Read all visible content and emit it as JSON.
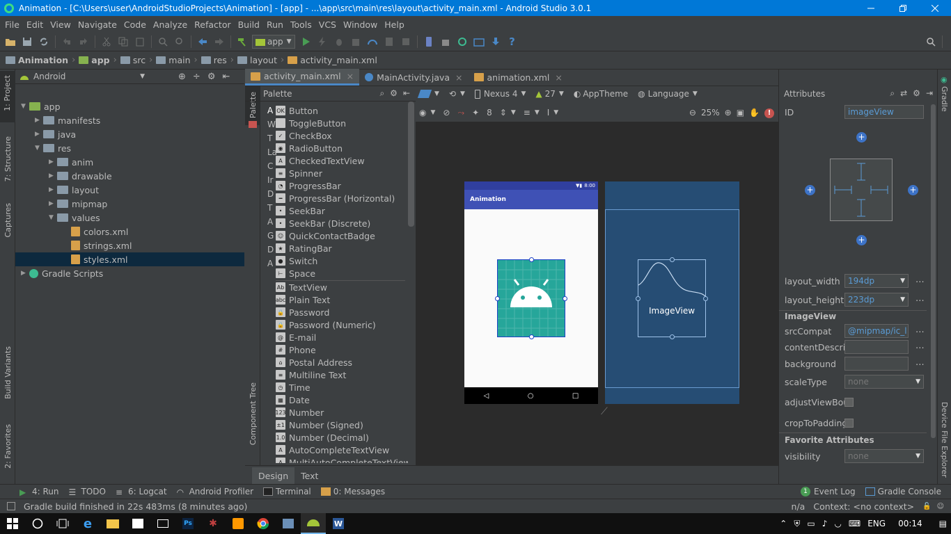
{
  "window": {
    "title": "Animation - [C:\\Users\\user\\AndroidStudioProjects\\Animation] - [app] - ...\\app\\src\\main\\res\\layout\\activity_main.xml - Android Studio 3.0.1"
  },
  "menu": [
    "File",
    "Edit",
    "View",
    "Navigate",
    "Code",
    "Analyze",
    "Refactor",
    "Build",
    "Run",
    "Tools",
    "VCS",
    "Window",
    "Help"
  ],
  "toolbar": {
    "run_config": "app"
  },
  "breadcrumb": [
    "Animation",
    "app",
    "src",
    "main",
    "res",
    "layout",
    "activity_main.xml"
  ],
  "left_stripe": {
    "project": "1: Project",
    "structure": "7: Structure",
    "captures": "Captures",
    "build_variants": "Build Variants",
    "favorites": "2: Favorites"
  },
  "project": {
    "view_mode": "Android",
    "tree": [
      {
        "label": "app",
        "depth": 0,
        "expanded": true,
        "kind": "module"
      },
      {
        "label": "manifests",
        "depth": 1,
        "expanded": false,
        "kind": "folder"
      },
      {
        "label": "java",
        "depth": 1,
        "expanded": false,
        "kind": "folder"
      },
      {
        "label": "res",
        "depth": 1,
        "expanded": true,
        "kind": "resfolder"
      },
      {
        "label": "anim",
        "depth": 2,
        "expanded": false,
        "kind": "folder"
      },
      {
        "label": "drawable",
        "depth": 2,
        "expanded": false,
        "kind": "folder"
      },
      {
        "label": "layout",
        "depth": 2,
        "expanded": false,
        "kind": "folder"
      },
      {
        "label": "mipmap",
        "depth": 2,
        "expanded": false,
        "kind": "folder"
      },
      {
        "label": "values",
        "depth": 2,
        "expanded": true,
        "kind": "folder"
      },
      {
        "label": "colors.xml",
        "depth": 3,
        "kind": "xml"
      },
      {
        "label": "strings.xml",
        "depth": 3,
        "kind": "xml"
      },
      {
        "label": "styles.xml",
        "depth": 3,
        "kind": "xml",
        "selected": true
      },
      {
        "label": "Gradle Scripts",
        "depth": 0,
        "expanded": false,
        "kind": "gradle"
      }
    ]
  },
  "editor_tabs": [
    {
      "label": "activity_main.xml",
      "active": true
    },
    {
      "label": "MainActivity.java"
    },
    {
      "label": "animation.xml"
    }
  ],
  "palette": {
    "title": "Palette",
    "vertical_tab": "Palette",
    "component_tree_tab": "Component Tree",
    "categories": [
      "A",
      "W",
      "T",
      "La",
      "C",
      "Ir",
      "D",
      "T",
      "A",
      "G",
      "D",
      "A"
    ],
    "items": [
      {
        "label": "Button",
        "icon": "OK"
      },
      {
        "label": "ToggleButton",
        "icon": ""
      },
      {
        "label": "CheckBox",
        "icon": "✓"
      },
      {
        "label": "RadioButton",
        "icon": "◉"
      },
      {
        "label": "CheckedTextView",
        "icon": "A"
      },
      {
        "label": "Spinner",
        "icon": "≡"
      },
      {
        "label": "ProgressBar",
        "icon": "◔"
      },
      {
        "label": "ProgressBar (Horizontal)",
        "icon": "━"
      },
      {
        "label": "SeekBar",
        "icon": "•"
      },
      {
        "label": "SeekBar (Discrete)",
        "icon": "•"
      },
      {
        "label": "QuickContactBadge",
        "icon": "☺"
      },
      {
        "label": "RatingBar",
        "icon": "★"
      },
      {
        "label": "Switch",
        "icon": "●"
      },
      {
        "label": "Space",
        "icon": "⊢"
      },
      {
        "label": "TextView",
        "icon": "Ab"
      },
      {
        "label": "Plain Text",
        "icon": "abc"
      },
      {
        "label": "Password",
        "icon": "🔒"
      },
      {
        "label": "Password (Numeric)",
        "icon": "🔒"
      },
      {
        "label": "E-mail",
        "icon": "@"
      },
      {
        "label": "Phone",
        "icon": "#"
      },
      {
        "label": "Postal Address",
        "icon": "⌂"
      },
      {
        "label": "Multiline Text",
        "icon": "≡"
      },
      {
        "label": "Time",
        "icon": "◷"
      },
      {
        "label": "Date",
        "icon": "▦"
      },
      {
        "label": "Number",
        "icon": "123"
      },
      {
        "label": "Number (Signed)",
        "icon": "±1"
      },
      {
        "label": "Number (Decimal)",
        "icon": "1.0"
      },
      {
        "label": "AutoCompleteTextView",
        "icon": "A"
      },
      {
        "label": "MultiAutoCompleteTextView",
        "icon": "A"
      }
    ]
  },
  "layout_toolbar": {
    "device": "Nexus 4",
    "api": "27",
    "theme": "AppTheme",
    "language": "Language",
    "margin": "8",
    "zoom": "25%"
  },
  "preview": {
    "status_time": "8:00",
    "app_title": "Animation",
    "blueprint_label": "ImageView"
  },
  "design_tabs": [
    {
      "label": "Design",
      "active": true
    },
    {
      "label": "Text"
    }
  ],
  "attributes": {
    "title": "Attributes",
    "id_label": "ID",
    "id_value": "imageView",
    "layout_width_label": "layout_width",
    "layout_width": "194dp",
    "layout_height_label": "layout_height",
    "layout_height": "223dp",
    "section_imageview": "ImageView",
    "srccompat_label": "srcCompat",
    "srccompat": "@mipmap/ic_l",
    "contentdesc_label": "contentDescrip",
    "background_label": "background",
    "scaletype_label": "scaleType",
    "scaletype": "none",
    "adjust_label": "adjustViewBour",
    "crop_label": "cropToPadding",
    "section_fav": "Favorite Attributes",
    "visibility_label": "visibility",
    "visibility": "none"
  },
  "right_stripe": {
    "gradle": "Gradle",
    "device_explorer": "Device File Explorer"
  },
  "tool_windows": [
    {
      "label": "4: Run"
    },
    {
      "label": "TODO"
    },
    {
      "label": "6: Logcat"
    },
    {
      "label": "Android Profiler"
    },
    {
      "label": "Terminal"
    },
    {
      "label": "0: Messages"
    }
  ],
  "tool_windows_right": [
    {
      "label": "Event Log",
      "badge": "1"
    },
    {
      "label": "Gradle Console"
    }
  ],
  "status": {
    "message": "Gradle build finished in 22s 483ms (8 minutes ago)",
    "na": "n/a",
    "context": "Context: <no context>"
  },
  "taskbar": {
    "lang": "ENG",
    "time": "00:14"
  },
  "colors": {
    "accent": "#4a88c7",
    "selection": "#0d293e",
    "blueprint": "#264d74",
    "android_teal": "#26a69a",
    "toolbar_primary": "#3f51b5"
  }
}
